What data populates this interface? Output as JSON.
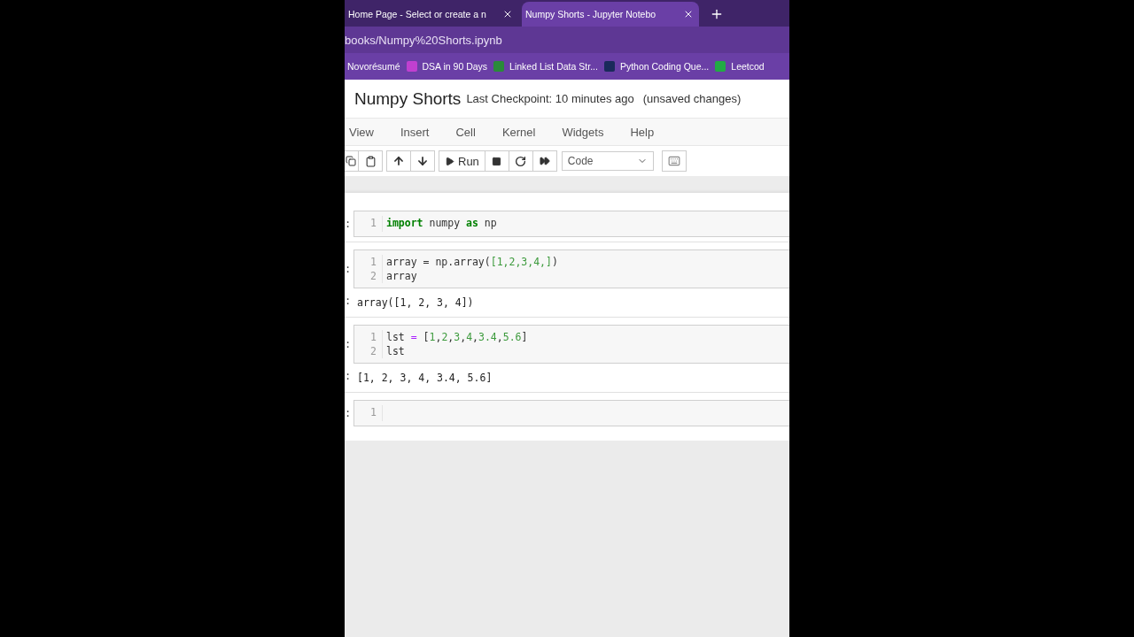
{
  "browser": {
    "tabs": [
      {
        "title": "Home Page - Select or create a n",
        "selected": false
      },
      {
        "title": "Numpy Shorts - Jupyter Notebo",
        "selected": true
      }
    ],
    "address": "books/Numpy%20Shorts.ipynb",
    "bookmarks": [
      {
        "label": "Novorésumé"
      },
      {
        "label": "DSA in 90 Days"
      },
      {
        "label": "Linked List Data Str..."
      },
      {
        "label": "Python Coding Que..."
      },
      {
        "label": "Leetcod"
      }
    ]
  },
  "notebook": {
    "title": "Numpy Shorts",
    "checkpoint": "Last Checkpoint: 10 minutes ago",
    "status": "(unsaved changes)",
    "menu": [
      "View",
      "Insert",
      "Cell",
      "Kernel",
      "Widgets",
      "Help"
    ],
    "toolbar": {
      "run_label": "Run",
      "cell_type": "Code"
    },
    "cells": [
      {
        "prompt": ":",
        "lines": [
          {
            "number": "1",
            "tokens": [
              {
                "text": "import",
                "kind": "keyword"
              },
              {
                "text": " numpy ",
                "kind": "plain"
              },
              {
                "text": "as",
                "kind": "keyword"
              },
              {
                "text": " np",
                "kind": "plain"
              }
            ]
          }
        ]
      },
      {
        "prompt": ":",
        "lines": [
          {
            "number": "1",
            "tokens": [
              {
                "text": "array = np.array(",
                "kind": "plain"
              },
              {
                "text": "[1,2,3,4,]",
                "kind": "number"
              },
              {
                "text": ")",
                "kind": "plain"
              }
            ]
          },
          {
            "number": "2",
            "tokens": [
              {
                "text": "array",
                "kind": "plain"
              }
            ]
          }
        ],
        "output": {
          "prompt": ":",
          "text": "array([1, 2, 3, 4])"
        }
      },
      {
        "prompt": ":",
        "lines": [
          {
            "number": "1",
            "tokens": [
              {
                "text": "lst ",
                "kind": "plain"
              },
              {
                "text": "=",
                "kind": "operator"
              },
              {
                "text": " [",
                "kind": "plain"
              },
              {
                "text": "1",
                "kind": "number"
              },
              {
                "text": ",",
                "kind": "plain"
              },
              {
                "text": "2",
                "kind": "number"
              },
              {
                "text": ",",
                "kind": "plain"
              },
              {
                "text": "3",
                "kind": "number"
              },
              {
                "text": ",",
                "kind": "plain"
              },
              {
                "text": "4",
                "kind": "number"
              },
              {
                "text": ",",
                "kind": "plain"
              },
              {
                "text": "3.4",
                "kind": "number"
              },
              {
                "text": ",",
                "kind": "plain"
              },
              {
                "text": "5.6",
                "kind": "number"
              },
              {
                "text": "]",
                "kind": "plain"
              }
            ]
          },
          {
            "number": "2",
            "tokens": [
              {
                "text": "lst",
                "kind": "plain"
              }
            ]
          }
        ],
        "output": {
          "prompt": ":",
          "text": "[1, 2, 3, 4, 3.4, 5.6]"
        }
      },
      {
        "prompt": ":",
        "lines": [
          {
            "number": "1"
          }
        ]
      }
    ]
  }
}
